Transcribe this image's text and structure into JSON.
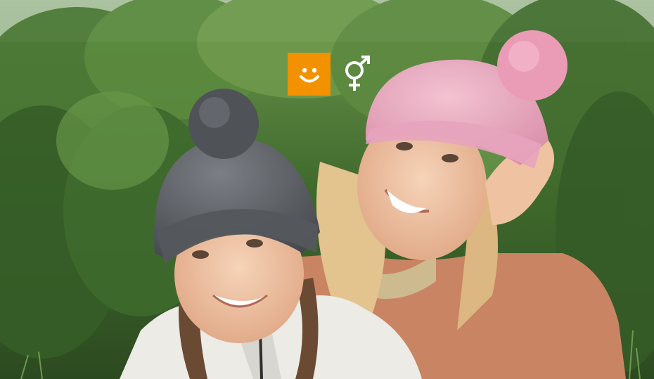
{
  "image": {
    "description_icon_names": [
      "smiley-icon",
      "unisex-gender-icon"
    ]
  },
  "badges": {
    "kids_icon": "smiley-icon",
    "kids_color": "#f39200",
    "gender_icon": "unisex-gender-icon",
    "gender_color": "#ffffff"
  },
  "palette": {
    "foliage_dark": "#2f4a22",
    "foliage_mid": "#4f7a36",
    "foliage_light": "#8fb26a",
    "sky": "#e9eef0",
    "grey_beanie": "#5a5d63",
    "pink_beanie": "#e8a9be",
    "pink_pompom": "#e996b2",
    "coat": "#c98463",
    "vest": "#ecebe6",
    "hair_blonde": "#e6c99a",
    "hair_brown": "#6b4a33",
    "skin": "#f1c8a8"
  }
}
